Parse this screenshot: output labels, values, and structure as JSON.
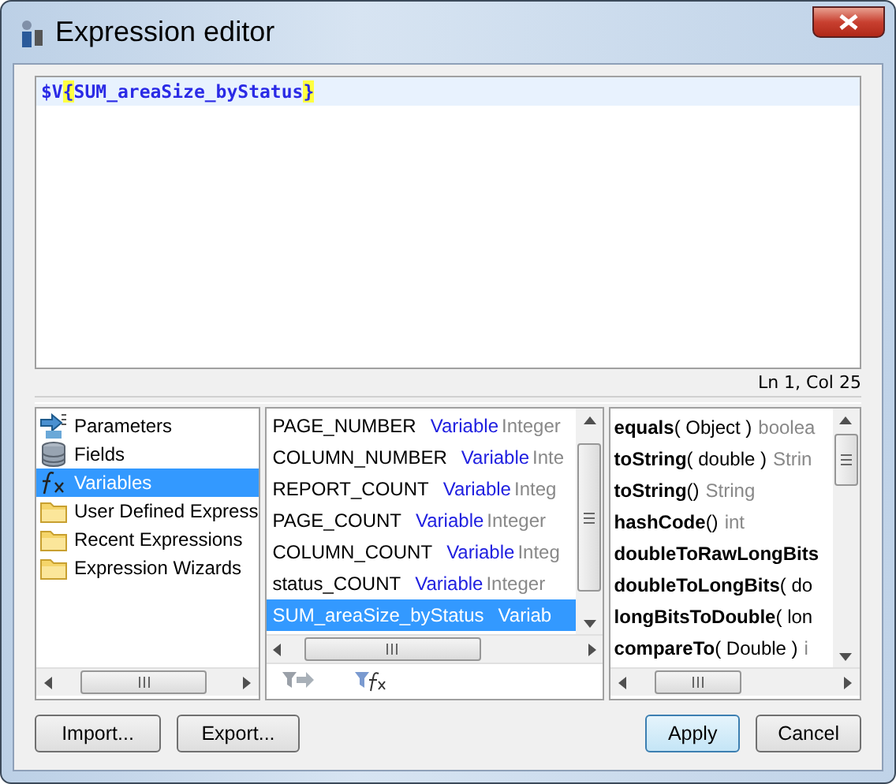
{
  "window": {
    "title": "Expression editor"
  },
  "editor": {
    "tokens": [
      {
        "text": "$V",
        "highlight": false
      },
      {
        "text": "{",
        "highlight": true
      },
      {
        "text": "SUM_areaSize_byStatus",
        "highlight": false
      },
      {
        "text": "}",
        "highlight": true
      }
    ],
    "position": "Ln 1, Col 25"
  },
  "categories": [
    {
      "label": "Parameters",
      "kind": "parameters",
      "selected": false
    },
    {
      "label": "Fields",
      "kind": "fields",
      "selected": false
    },
    {
      "label": "Variables",
      "kind": "variables",
      "selected": true
    },
    {
      "label": "User Defined Express",
      "kind": "folder",
      "selected": false
    },
    {
      "label": "Recent Expressions",
      "kind": "folder",
      "selected": false
    },
    {
      "label": "Expression Wizards",
      "kind": "folder",
      "selected": false
    }
  ],
  "objects": [
    {
      "name": "PAGE_NUMBER",
      "kind": "Variable",
      "type": "Integer",
      "selected": false
    },
    {
      "name": "COLUMN_NUMBER",
      "kind": "Variable",
      "type": "Inte",
      "selected": false
    },
    {
      "name": "REPORT_COUNT",
      "kind": "Variable",
      "type": "Integ",
      "selected": false
    },
    {
      "name": "PAGE_COUNT",
      "kind": "Variable",
      "type": "Integer",
      "selected": false
    },
    {
      "name": "COLUMN_COUNT",
      "kind": "Variable",
      "type": "Integ",
      "selected": false
    },
    {
      "name": "status_COUNT",
      "kind": "Variable",
      "type": "Integer",
      "selected": false
    },
    {
      "name": "SUM_areaSize_byStatus",
      "kind": "Variab",
      "selected": true
    }
  ],
  "methods": [
    {
      "name": "equals",
      "args": "( Object )",
      "returns": "boolea"
    },
    {
      "name": "toString",
      "args": "( double )",
      "returns": "Strin"
    },
    {
      "name": "toString",
      "args": "()",
      "returns": "String"
    },
    {
      "name": "hashCode",
      "args": "()",
      "returns": "int"
    },
    {
      "name": "doubleToRawLongBits"
    },
    {
      "name": "doubleToLongBits",
      "args": "( do"
    },
    {
      "name": "longBitsToDouble",
      "args": "( lon"
    },
    {
      "name": "compareTo",
      "args": "( Double )",
      "returns": "i"
    }
  ],
  "buttons": [
    {
      "label": "Import...",
      "kind": "plain"
    },
    {
      "label": "Export...",
      "kind": "plain"
    },
    {
      "label": "Apply",
      "kind": "default"
    },
    {
      "label": "Cancel",
      "kind": "plain"
    }
  ]
}
